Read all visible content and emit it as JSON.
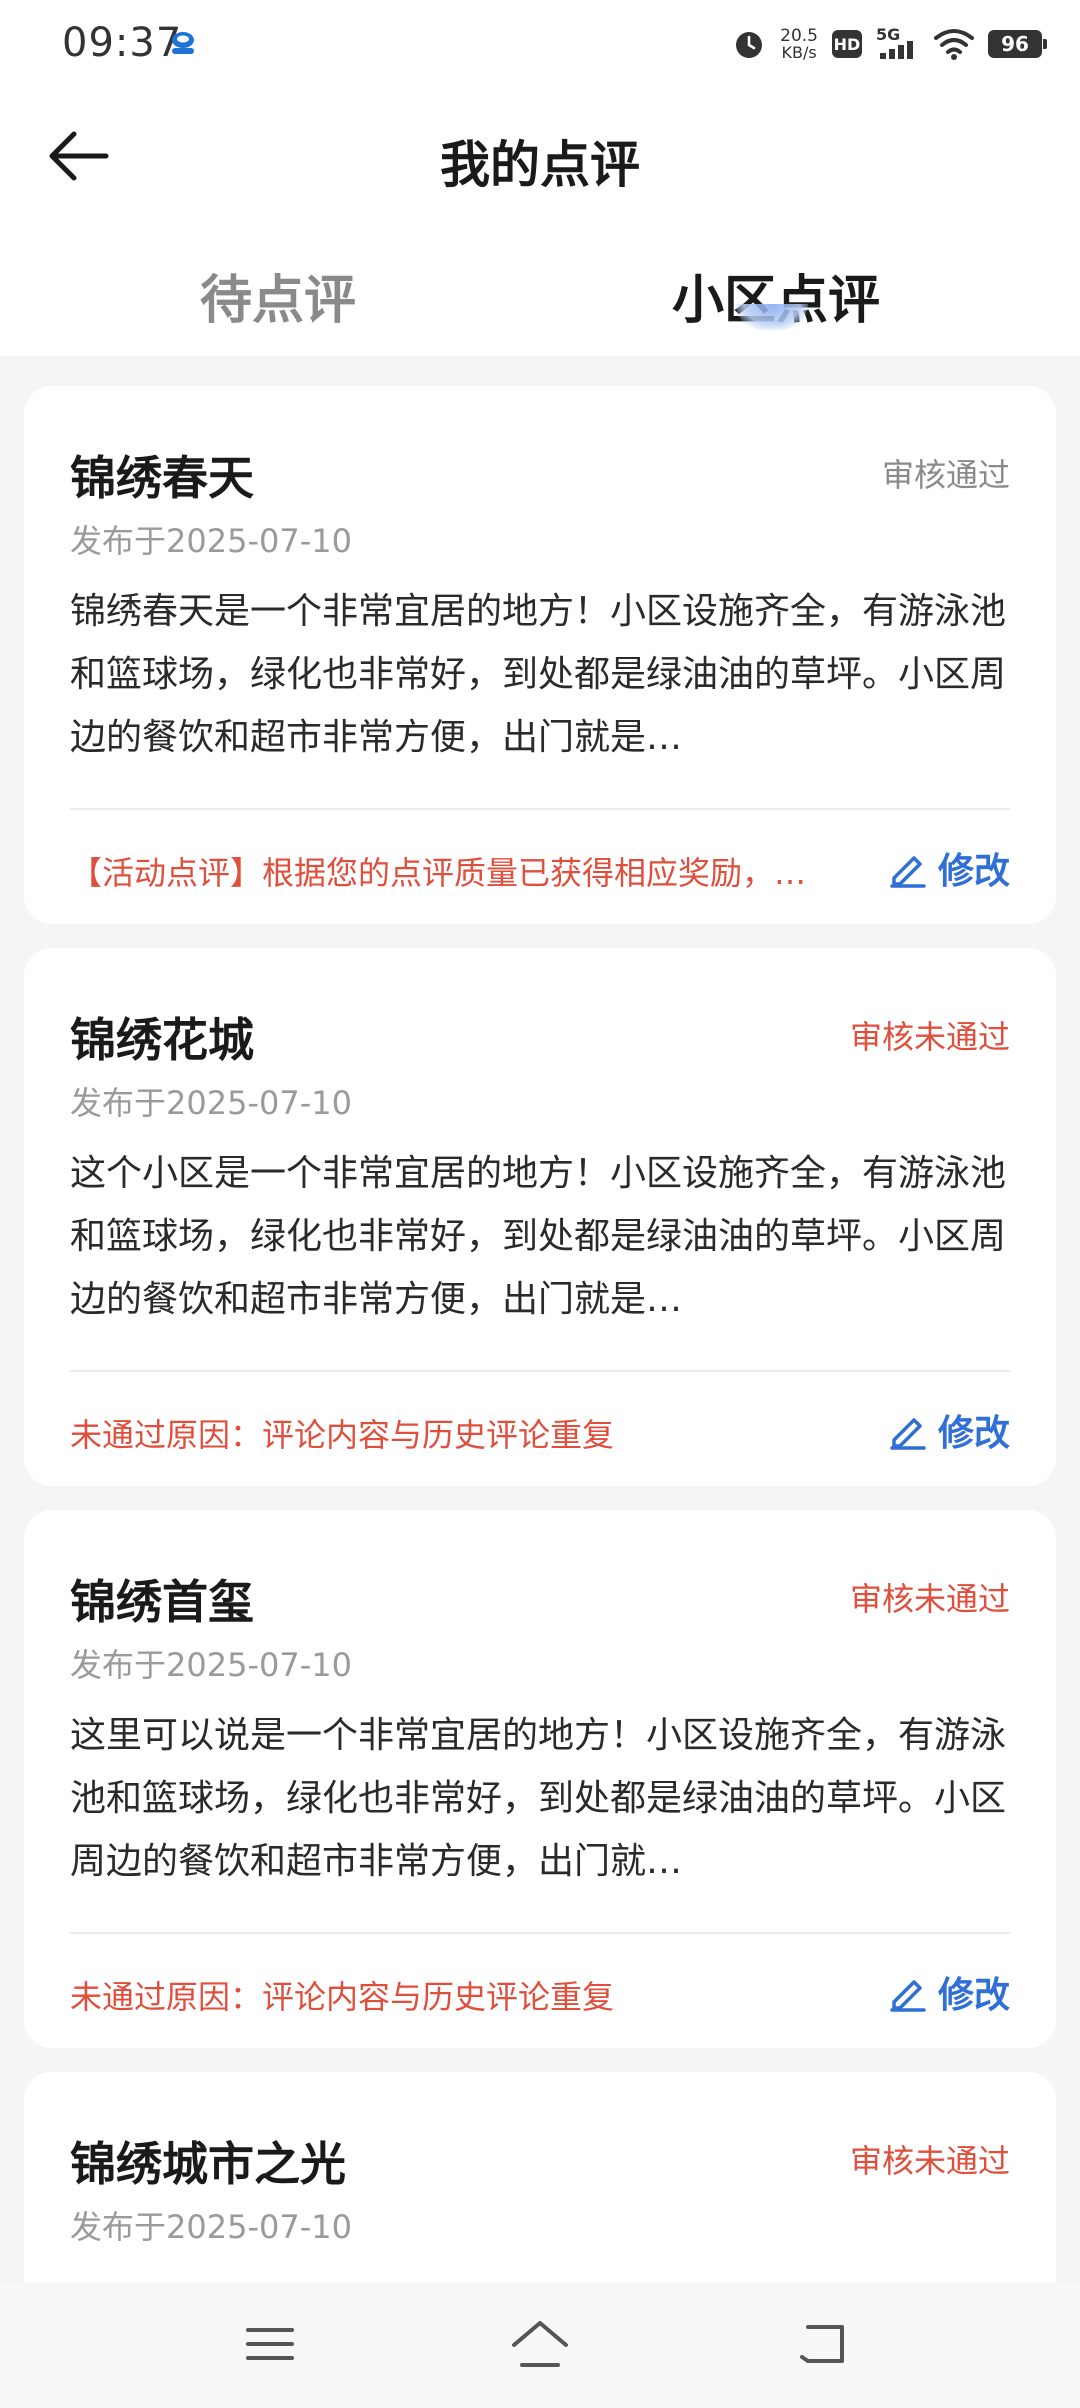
{
  "status_bar": {
    "time": "09:37",
    "net_speed_value": "20.5",
    "net_speed_unit": "KB/s",
    "hd_label": "HD",
    "signal_label": "5G",
    "battery": "96"
  },
  "header": {
    "title": "我的点评"
  },
  "tabs": [
    {
      "label": "待点评",
      "active": false
    },
    {
      "label": "小区点评",
      "active": true
    }
  ],
  "colors": {
    "accent_blue": "#2f6fd6",
    "error_red": "#e04e3c",
    "muted_gray": "#8a8a8a"
  },
  "reviews": [
    {
      "title": "锦绣春天",
      "status": "审核通过",
      "date": "发布于2025-07-10",
      "content": "锦绣春天是一个非常宜居的地方！小区设施齐全，有游泳池和篮球场，绿化也非常好，到处都是绿油油的草坪。小区周边的餐饮和超市非常方便，出门就是…",
      "note": "【活动点评】根据您的点评质量已获得相应奖励，…",
      "edit_label": "修改"
    },
    {
      "title": "锦绣花城",
      "status": "审核未通过",
      "date": "发布于2025-07-10",
      "content": "这个小区是一个非常宜居的地方！小区设施齐全，有游泳池和篮球场，绿化也非常好，到处都是绿油油的草坪。小区周边的餐饮和超市非常方便，出门就是…",
      "note": "未通过原因：评论内容与历史评论重复",
      "edit_label": "修改"
    },
    {
      "title": "锦绣首玺",
      "status": "审核未通过",
      "date": "发布于2025-07-10",
      "content": "这里可以说是一个非常宜居的地方！小区设施齐全，有游泳池和篮球场，绿化也非常好，到处都是绿油油的草坪。小区周边的餐饮和超市非常方便，出门就…",
      "note": "未通过原因：评论内容与历史评论重复",
      "edit_label": "修改"
    },
    {
      "title": "锦绣城市之光",
      "status": "审核未通过",
      "date": "发布于2025-07-10"
    }
  ],
  "nav": {
    "icons": [
      "menu-icon",
      "home-icon",
      "back-icon"
    ]
  }
}
